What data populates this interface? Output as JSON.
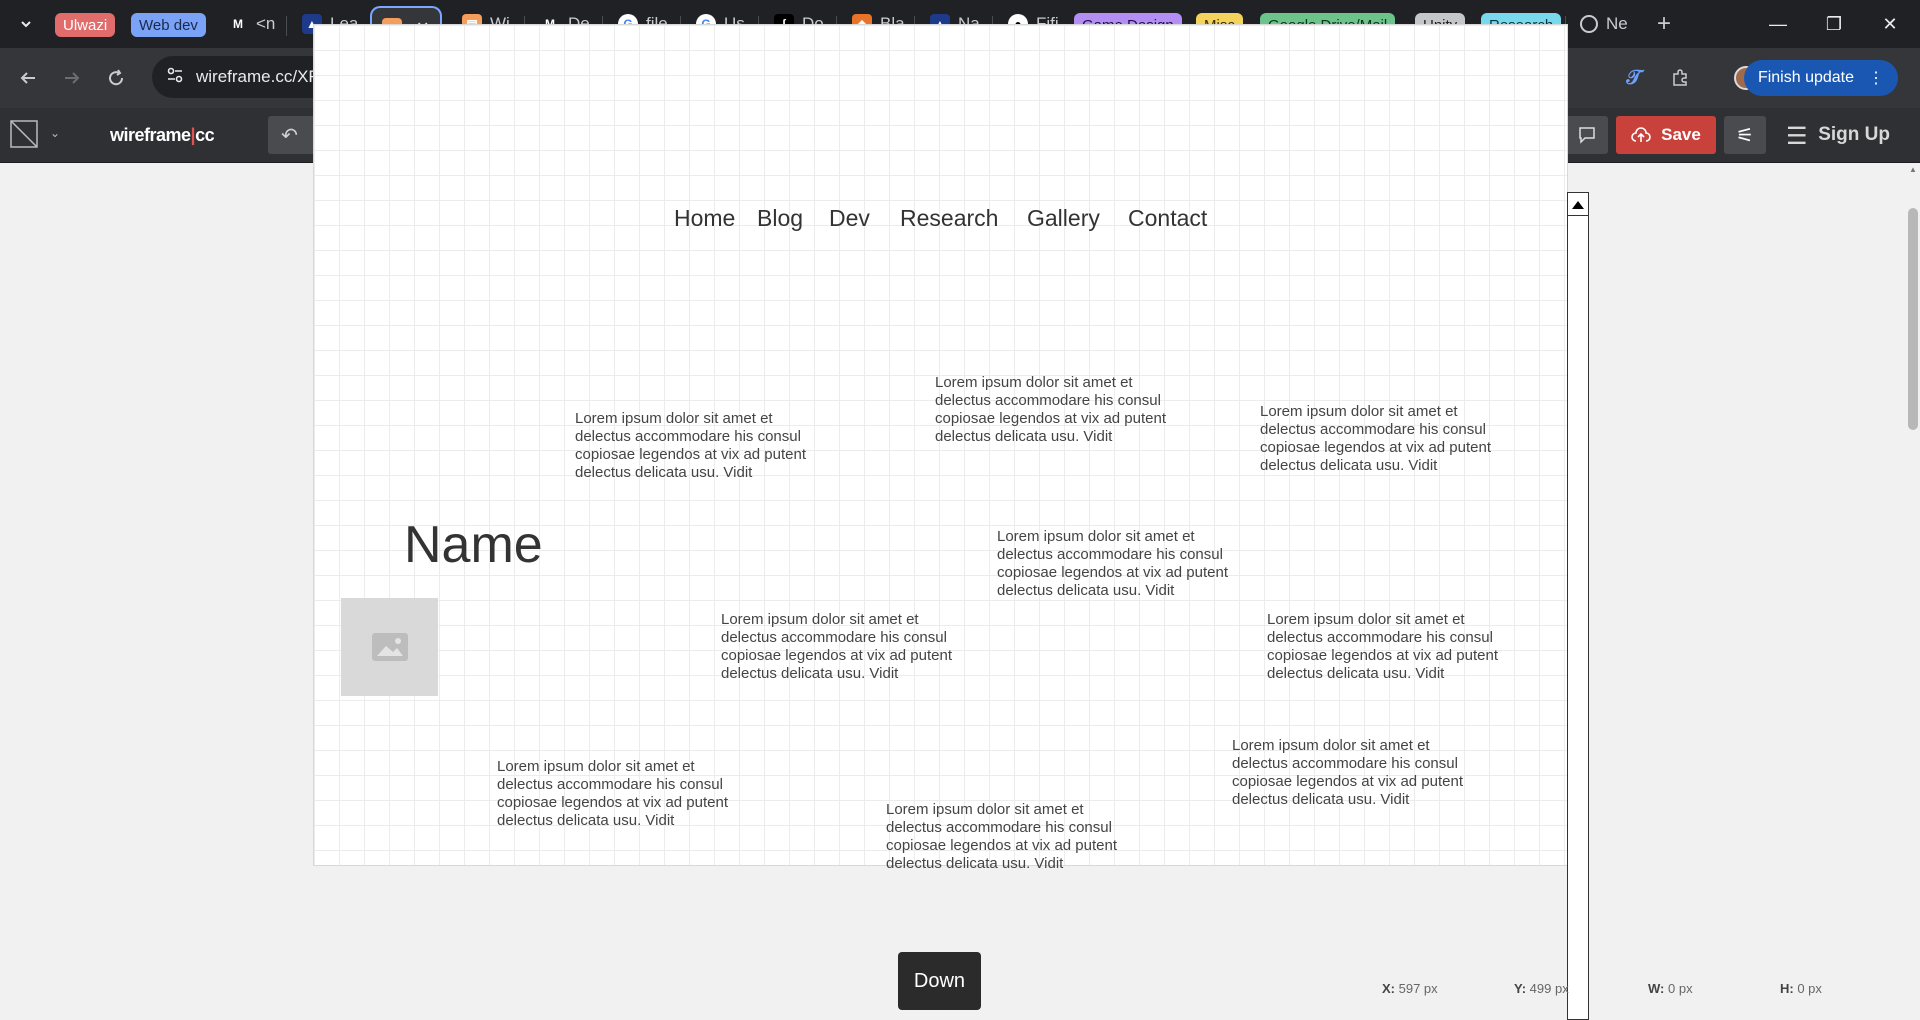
{
  "tabs": {
    "chips": [
      "Ulwazi",
      "Web dev",
      "Game Design",
      "Misc",
      "Google Drive/Mail",
      "Unity",
      "Research"
    ],
    "items": [
      "<n",
      "Lea",
      "",
      "Wi",
      "De",
      "file",
      "Us",
      "Do",
      "Bla",
      "Na",
      "Fifi",
      "Ne"
    ]
  },
  "colors": {
    "ulwazi": "#e06c6c",
    "webdev": "#7aa2f7",
    "gamedesign": "#b48ef5",
    "misc": "#f3d35c",
    "gdrive": "#6cc48a",
    "unity": "#c5c6c9",
    "research": "#78d8ec",
    "save": "#c9413b",
    "accent": "#1a57b3"
  },
  "address": {
    "url": "wireframe.cc/XRSxsK"
  },
  "browser": {
    "finish_update": "Finish update"
  },
  "app": {
    "logo_left": "wireframe",
    "logo_right": "cc",
    "save": "Save",
    "signup": "Sign Up"
  },
  "wire": {
    "nav": [
      "Home",
      "Blog",
      "Dev",
      "Research",
      "Gallery",
      "Contact"
    ],
    "name": "Name",
    "lorem": "Lorem ipsum dolor sit amet et delectus accommodare his consul copiosae legendos at vix ad putent delectus delicata usu. Vidit",
    "down": "Down"
  },
  "coords": {
    "x_label": "X:",
    "x": "597 px",
    "y_label": "Y:",
    "y": "499 px",
    "w_label": "W:",
    "w": "0 px",
    "h_label": "H:",
    "h": "0 px"
  }
}
